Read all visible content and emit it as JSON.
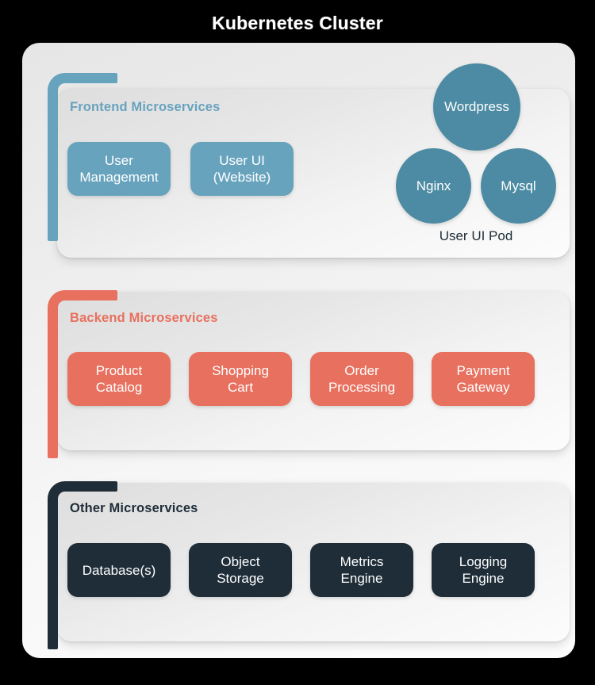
{
  "title": "Kubernetes Cluster",
  "colors": {
    "frontend": "#68A3BE",
    "backend": "#E8705E",
    "other": "#1E2D38",
    "pod_circle": "#4C8BA3",
    "canvas": "#000000",
    "card": "#f2f2f2"
  },
  "sections": [
    {
      "id": "frontend",
      "title": "Frontend Microservices",
      "services": [
        "User\nManagement",
        "User UI\n(Website)"
      ]
    },
    {
      "id": "backend",
      "title": "Backend Microservices",
      "services": [
        "Product\nCatalog",
        "Shopping\nCart",
        "Order\nProcessing",
        "Payment\nGateway"
      ]
    },
    {
      "id": "other",
      "title": "Other Microservices",
      "services": [
        "Database(s)",
        "Object\nStorage",
        "Metrics\nEngine",
        "Logging\nEngine"
      ]
    }
  ],
  "pod": {
    "label": "User UI Pod",
    "containers": [
      {
        "name": "Wordpress",
        "size": "large"
      },
      {
        "name": "Nginx",
        "size": "small"
      },
      {
        "name": "Mysql",
        "size": "small"
      }
    ]
  }
}
